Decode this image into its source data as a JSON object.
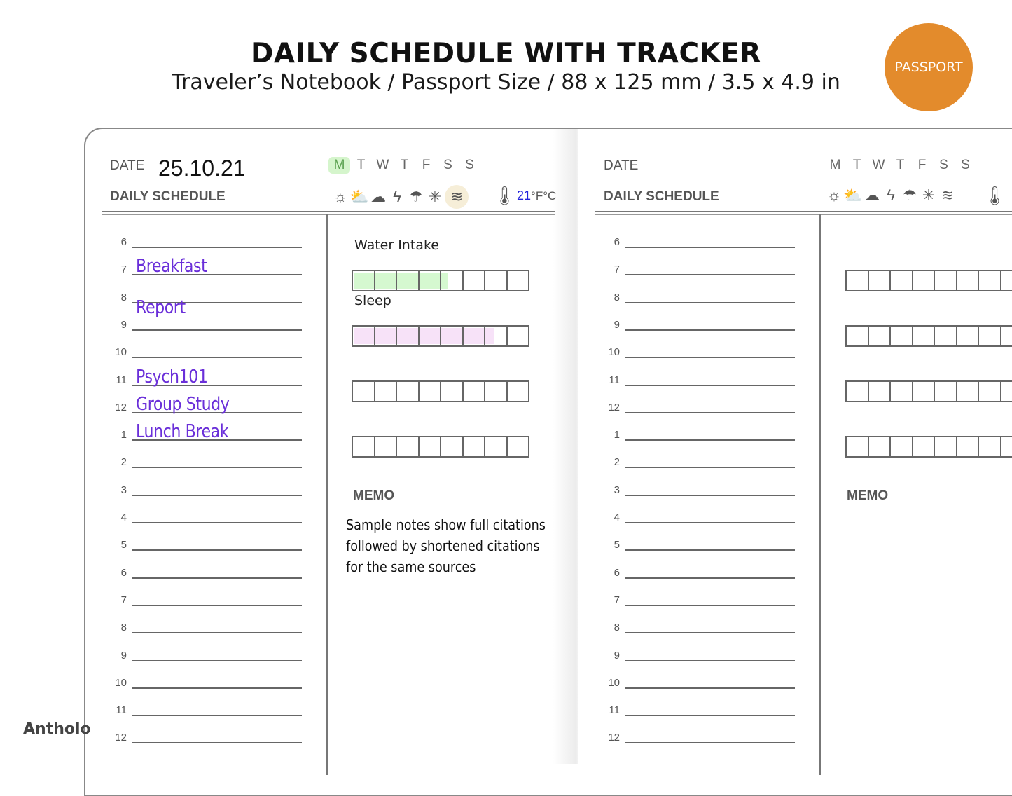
{
  "header": {
    "title": "DAILY SCHEDULE WITH TRACKER",
    "subtitle": "Traveler’s Notebook / Passport Size / 88 x 125 mm / 3.5 x 4.9 in",
    "badge": "PASSPORT",
    "badge_color": "#E38B2C"
  },
  "brand": "Antholo",
  "weekdays": [
    "M",
    "T",
    "W",
    "T",
    "F",
    "S",
    "S"
  ],
  "weather_icons": [
    "sunny-icon",
    "partly-cloudy-icon",
    "cloudy-icon",
    "thunder-icon",
    "rain-icon",
    "snow-icon",
    "wind-icon"
  ],
  "weather_glyphs": [
    "☼",
    "⛅",
    "☁",
    "ϟ",
    "☂",
    "✳",
    "≋"
  ],
  "hours": [
    "6",
    "7",
    "8",
    "9",
    "10",
    "11",
    "12",
    "1",
    "2",
    "3",
    "4",
    "5",
    "6",
    "7",
    "8",
    "9",
    "10",
    "11",
    "12"
  ],
  "left_page": {
    "date_label": "DATE",
    "date_value": "25.10.21",
    "active_weekday_index": 0,
    "schedule_label": "DAILY SCHEDULE",
    "selected_weather": "wind-icon",
    "temperature": "21",
    "temp_units": "°F°C",
    "entries": [
      {
        "hour_index": 1,
        "text": "Breakfast"
      },
      {
        "hour_index": 3,
        "text": "Report",
        "offset": "below-8"
      },
      {
        "hour_index": 5,
        "text": "Psych101"
      },
      {
        "hour_index": 6,
        "text": "Group Study"
      },
      {
        "hour_index": 7,
        "text": "Lunch Break"
      }
    ],
    "trackers": [
      {
        "label": "Water Intake",
        "boxes": 8,
        "filled": 4.3,
        "fill_color": "#d5f8d0"
      },
      {
        "label": "Sleep",
        "boxes": 8,
        "filled": 6.4,
        "fill_color": "#f7e2f8"
      },
      {
        "label": "",
        "boxes": 8,
        "filled": 0
      },
      {
        "label": "",
        "boxes": 8,
        "filled": 0
      }
    ],
    "memo_label": "MEMO",
    "memo_lines": [
      "Sample notes show full citations",
      "followed by shortened citations",
      "for the same sources"
    ]
  },
  "right_page": {
    "date_label": "DATE",
    "date_value": "",
    "schedule_label": "DAILY SCHEDULE",
    "trackers": [
      {
        "boxes": 8,
        "filled": 0
      },
      {
        "boxes": 8,
        "filled": 0
      },
      {
        "boxes": 8,
        "filled": 0
      },
      {
        "boxes": 8,
        "filled": 0
      }
    ],
    "memo_label": "MEMO"
  },
  "colors": {
    "handwriting": "#6a2fd9",
    "active_day_bg": "#d5f5cc",
    "temperature": "#2222dd"
  }
}
